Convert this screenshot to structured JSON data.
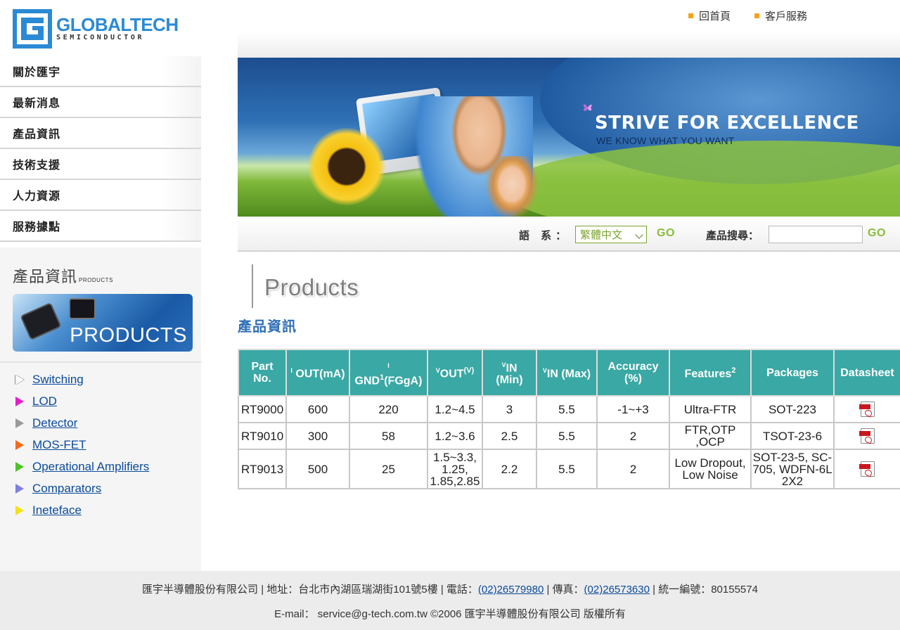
{
  "header": {
    "brand": "GLOBALTECH",
    "brand_sub": "SEMICONDUCTOR",
    "links": [
      {
        "label": "回首頁"
      },
      {
        "label": "客戶服務"
      }
    ]
  },
  "nav": {
    "items": [
      {
        "label": "關於匯宇"
      },
      {
        "label": "最新消息"
      },
      {
        "label": "產品資訊"
      },
      {
        "label": "技術支援"
      },
      {
        "label": "人力資源"
      },
      {
        "label": "服務據點"
      }
    ]
  },
  "products_panel": {
    "title": "產品資訊",
    "title_small": "PRODUCTS",
    "banner_text": "PRODUCTS",
    "categories": [
      {
        "label": "Switching",
        "color": "#ffffff"
      },
      {
        "label": "LOD",
        "color": "#e020c8"
      },
      {
        "label": "Detector",
        "color": "#9a9a9a"
      },
      {
        "label": "MOS-FET",
        "color": "#f26a1b"
      },
      {
        "label": "Operational Amplifiers",
        "color": "#4ec226"
      },
      {
        "label": "Comparators",
        "color": "#7d80e0"
      },
      {
        "label": "Ineteface",
        "color": "#f3e21a"
      }
    ]
  },
  "hero": {
    "slogan": "STRIVE FOR EXCELLENCE",
    "sub": "WE KNOW  WHAT YOU WANT"
  },
  "search": {
    "lang_label": "語 系：",
    "lang_value": "繁體中文",
    "go1": "GO",
    "search_label": "產品搜尋：",
    "search_value": "",
    "go2": "GO"
  },
  "main": {
    "page_title": "Products",
    "section_title": "產品資訊"
  },
  "table": {
    "headers": {
      "part": [
        "Part",
        "No."
      ],
      "iout_i": "I",
      "iout": "OUT(mA)",
      "ignd_i": "I",
      "ignd": "GND",
      "ignd_sup": "1",
      "ignd_unit": "(FGgA)",
      "vout_v": "V",
      "vout": "OUT",
      "vout_sup": "(V)",
      "vinmin_v": "V",
      "vinmin": "IN",
      "vinmin_unit": "(Min)",
      "vinmax_v": "V",
      "vinmax": "IN (Max)",
      "acc": [
        "Accuracy",
        "(%)"
      ],
      "features": "Features",
      "features_sup": "2",
      "packages": "Packages",
      "datasheet": "Datasheet"
    },
    "rows": [
      {
        "part": "RT9000",
        "iout": "600",
        "ignd": "220",
        "vout": "1.2~4.5",
        "vinmin": "3",
        "vinmax": "5.5",
        "acc": "-1~+3",
        "features": "Ultra-FTR",
        "packages": "SOT-223"
      },
      {
        "part": "RT9010",
        "iout": "300",
        "ignd": "58",
        "vout": "1.2~3.6",
        "vinmin": "2.5",
        "vinmax": "5.5",
        "acc": "2",
        "features": "FTR,OTP ,OCP",
        "packages": "TSOT-23-6"
      },
      {
        "part": "RT9013",
        "iout": "500",
        "ignd": "25",
        "vout": "1.5~3.3, 1.25, 1.85,2.85",
        "vinmin": "2.2",
        "vinmax": "5.5",
        "acc": "2",
        "features": "Low Dropout, Low Noise",
        "packages": "SOT-23-5, SC-705, WDFN-6L 2X2"
      }
    ]
  },
  "footer": {
    "line1_a": "匯宇半導體股份有限公司 | 地址：台北市內湖區瑞湖街101號5樓 | 電話：",
    "phone": "(02)26579980",
    "line1_b": " | 傳真：",
    "fax": "(02)26573630",
    "line1_c": " | 統一編號：80155574",
    "line2": "E-mail： service@g-tech.com.tw ©2006 匯宇半導體股份有限公司 版權所有"
  }
}
